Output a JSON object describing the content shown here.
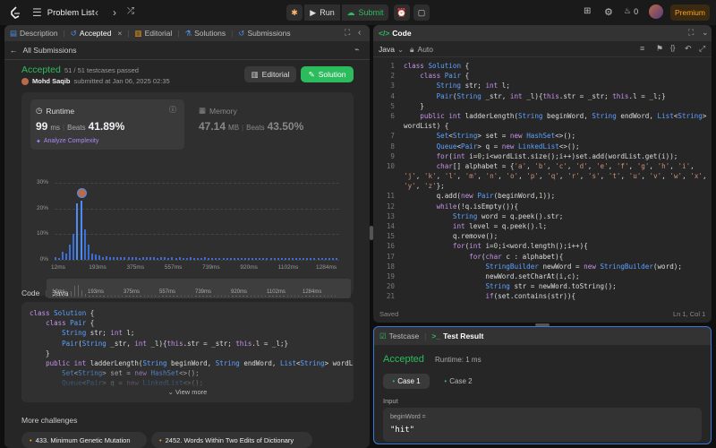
{
  "topbar": {
    "title": "Problem List",
    "run_label": "Run",
    "submit_label": "Submit",
    "streak": "0",
    "premium_label": "Premium"
  },
  "left_tabs": [
    {
      "label": "Description",
      "icon": "description-icon"
    },
    {
      "label": "Accepted",
      "icon": "history-icon",
      "active": true
    },
    {
      "label": "Editorial",
      "icon": "book-icon"
    },
    {
      "label": "Solutions",
      "icon": "flask-icon"
    },
    {
      "label": "Submissions",
      "icon": "history-icon"
    }
  ],
  "submission": {
    "back_label": "All Submissions",
    "status": "Accepted",
    "testcases": "51 / 51 testcases passed",
    "user": "Mohd Saqib",
    "submitted_at": "submitted at Jan 06, 2025 02:35",
    "editorial_btn": "Editorial",
    "solution_btn": "Solution",
    "runtime_label": "Runtime",
    "runtime_value": "99",
    "runtime_unit": "ms",
    "beats_label": "Beats",
    "runtime_beats": "41.89%",
    "analyze_label": "Analyze Complexity",
    "memory_label": "Memory",
    "memory_value": "47.14",
    "memory_unit": "MB",
    "memory_beats": "43.50%"
  },
  "chart_data": {
    "type": "bar",
    "y_ticks": [
      "30%",
      "20%",
      "10%",
      "0%"
    ],
    "ylim": [
      0,
      30
    ],
    "x_ticks": [
      "12ms",
      "193ms",
      "375ms",
      "557ms",
      "739ms",
      "920ms",
      "1102ms",
      "1284ms"
    ],
    "values": [
      1.2,
      0.8,
      3.2,
      2.5,
      6,
      10,
      22,
      23,
      12,
      6,
      2.4,
      2,
      1.6,
      1.2,
      1.3,
      1.1,
      1,
      0.9,
      1.1,
      1,
      0.9,
      1.1,
      1,
      0.8,
      1,
      0.9,
      0.9,
      1,
      0.8,
      0.9,
      1,
      0.8,
      0.9,
      0.8,
      0.9,
      0.8,
      0.8,
      0.9,
      0.8,
      0.8,
      0.8,
      0.9,
      0.8,
      0.8,
      0.8,
      0.8,
      0.8,
      0.8,
      0.8,
      0.8,
      0.8,
      0.8,
      0.8,
      0.8,
      0.8,
      0.8,
      0.8,
      0.8,
      0.8,
      0.8,
      0.8,
      0.8,
      0.8,
      0.8,
      0.8,
      0.8,
      0.8,
      0.8,
      0.8,
      0.8,
      0.8,
      0.8,
      0.8,
      0.8,
      0.8,
      0.8,
      0.8,
      0.8
    ],
    "highlight_index": 7
  },
  "code_section": {
    "label": "Code",
    "lang": "Java",
    "view_more": "View more",
    "lines": [
      "class Solution {",
      "    class Pair {",
      "        String str; int l;",
      "        Pair(String _str, int _l){this.str = _str; this.l = _l;}",
      "    }",
      "    public int ladderLength(String beginWord, String endWord, List<String> wordList) {",
      "        Set<String> set = new HashSet<>();",
      "        Queue<Pair> q = new LinkedList<>();"
    ]
  },
  "more_challenges": {
    "label": "More challenges",
    "items": [
      "433. Minimum Genetic Mutation",
      "2452. Words Within Two Edits of Dictionary"
    ]
  },
  "editor": {
    "title": "Code",
    "lang": "Java",
    "auto": "Auto",
    "saved": "Saved",
    "position": "Ln 1, Col 1",
    "lines": [
      "class Solution {",
      "    class Pair {",
      "        String str; int l;",
      "        Pair(String _str, int _l){this.str = _str; this.l = _l;}",
      "    }",
      "    public int ladderLength(String beginWord, String endWord, List<String>",
      "wordList) {",
      "        Set<String> set = new HashSet<>();",
      "        Queue<Pair> q = new LinkedList<>();",
      "        for(int i=0;i<wordList.size();i++)set.add(wordList.get(i));",
      "        char[] alphabet = {'a', 'b', 'c', 'd', 'e', 'f', 'g', 'h', 'i',",
      "'j', 'k', 'l', 'm', 'n', 'o', 'p', 'q', 'r', 's', 't', 'u', 'v', 'w', 'x',",
      "'y', 'z'};",
      "        q.add(new Pair(beginWord,1));",
      "        while(!q.isEmpty()){",
      "            String word = q.peek().str;",
      "            int level = q.peek().l;",
      "            q.remove();",
      "            for(int i=0;i<word.length();i++){",
      "                for(char c : alphabet){",
      "                    StringBuilder newWord = new StringBuilder(word);",
      "                    newWord.setCharAt(i,c);",
      "                    String str = newWord.toString();",
      "                    if(set.contains(str)){"
    ],
    "line_numbers": [
      "1",
      "2",
      "3",
      "4",
      "5",
      "6",
      "",
      "7",
      "8",
      "9",
      "10",
      "",
      "",
      "11",
      "12",
      "13",
      "14",
      "15",
      "16",
      "17",
      "18",
      "19",
      "20",
      "21"
    ]
  },
  "testpanel": {
    "testcase_tab": "Testcase",
    "result_tab": "Test Result",
    "status": "Accepted",
    "runtime": "Runtime: 1 ms",
    "cases": [
      "Case 1",
      "Case 2"
    ],
    "input_label": "Input",
    "param_name": "beginWord =",
    "param_value": "\"hit\""
  }
}
